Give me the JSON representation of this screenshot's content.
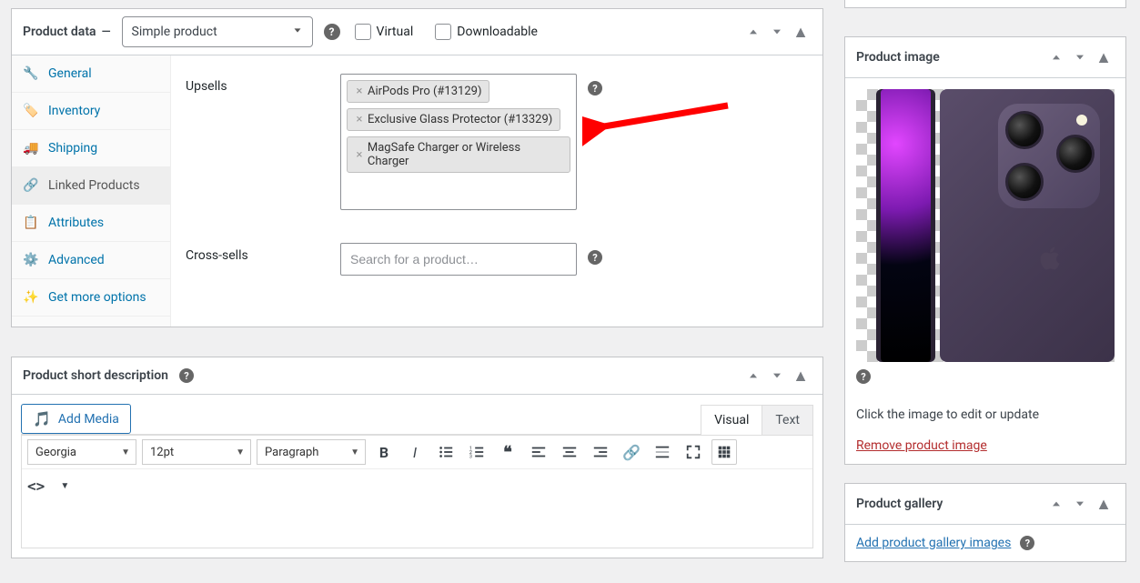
{
  "product_data": {
    "title": "Product data",
    "dash": "—",
    "type_selected": "Simple product",
    "virtual_label": "Virtual",
    "downloadable_label": "Downloadable",
    "tabs": {
      "general": "General",
      "inventory": "Inventory",
      "shipping": "Shipping",
      "linked": "Linked Products",
      "attributes": "Attributes",
      "advanced": "Advanced",
      "getmore": "Get more options"
    },
    "upsells": {
      "label": "Upsells",
      "items": [
        "AirPods Pro (#13129)",
        "Exclusive Glass Protector (#13329)",
        "MagSafe Charger or Wireless Charger"
      ]
    },
    "crosssells": {
      "label": "Cross-sells",
      "placeholder": "Search for a product…"
    }
  },
  "short_desc": {
    "title": "Product short description",
    "add_media": "Add Media",
    "tab_visual": "Visual",
    "tab_text": "Text",
    "font": "Georgia",
    "size": "12pt",
    "format": "Paragraph"
  },
  "sidebar": {
    "product_image": {
      "title": "Product image",
      "below_text": "Click the image to edit or update",
      "remove": "Remove product image"
    },
    "gallery": {
      "title": "Product gallery",
      "add": "Add product gallery images"
    }
  }
}
